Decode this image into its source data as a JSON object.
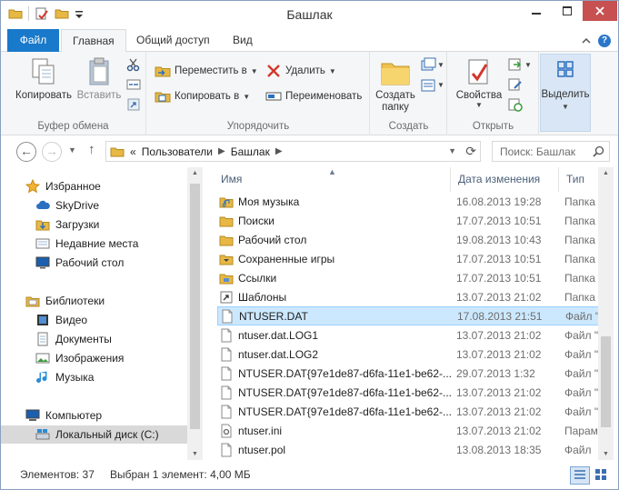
{
  "window": {
    "title": "Башлак",
    "colors": {
      "file_tab": "#1979ca",
      "selection": "#cce8ff",
      "close_button": "#c75050"
    }
  },
  "ribbon_tabs": {
    "file": "Файл",
    "home": "Главная",
    "share": "Общий доступ",
    "view": "Вид"
  },
  "ribbon": {
    "clipboard": {
      "copy": "Копировать",
      "paste": "Вставить",
      "label": "Буфер обмена"
    },
    "organize": {
      "move_to": "Переместить в",
      "copy_to": "Копировать в",
      "delete": "Удалить",
      "rename": "Переименовать",
      "label": "Упорядочить"
    },
    "new": {
      "new_folder_line1": "Создать",
      "new_folder_line2": "папку",
      "label": "Создать"
    },
    "open": {
      "properties": "Свойства",
      "label": "Открыть"
    },
    "select": {
      "select": "Выделить"
    }
  },
  "address": {
    "overflow": "«",
    "crumbs": [
      "Пользователи",
      "Башлак"
    ],
    "search_placeholder": "Поиск: Башлак"
  },
  "nav": {
    "favorites": "Избранное",
    "skydrive": "SkyDrive",
    "downloads": "Загрузки",
    "recent": "Недавние места",
    "desktop": "Рабочий стол",
    "libraries": "Библиотеки",
    "video": "Видео",
    "documents": "Документы",
    "pictures": "Изображения",
    "music": "Музыка",
    "computer": "Компьютер",
    "local_disk": "Локальный диск (C:)"
  },
  "columns": {
    "name": "Имя",
    "date": "Дата изменения",
    "type": "Тип"
  },
  "files": [
    {
      "name": "Моя музыка",
      "date": "16.08.2013 19:28",
      "type": "Папка",
      "icon": "folder-music-icon"
    },
    {
      "name": "Поиски",
      "date": "17.07.2013 10:51",
      "type": "Папка",
      "icon": "folder-icon"
    },
    {
      "name": "Рабочий стол",
      "date": "19.08.2013 10:43",
      "type": "Папка",
      "icon": "folder-icon"
    },
    {
      "name": "Сохраненные игры",
      "date": "17.07.2013 10:51",
      "type": "Папка",
      "icon": "folder-games-icon"
    },
    {
      "name": "Ссылки",
      "date": "17.07.2013 10:51",
      "type": "Папка",
      "icon": "folder-links-icon"
    },
    {
      "name": "Шаблоны",
      "date": "13.07.2013 21:02",
      "type": "Папка",
      "icon": "shortcut-icon"
    },
    {
      "name": "NTUSER.DAT",
      "date": "17.08.2013 21:51",
      "type": "Файл \"",
      "icon": "file-icon"
    },
    {
      "name": "ntuser.dat.LOG1",
      "date": "13.07.2013 21:02",
      "type": "Файл \"",
      "icon": "file-icon"
    },
    {
      "name": "ntuser.dat.LOG2",
      "date": "13.07.2013 21:02",
      "type": "Файл \"",
      "icon": "file-icon"
    },
    {
      "name": "NTUSER.DAT{97e1de87-d6fa-11e1-be62-...",
      "date": "29.07.2013 1:32",
      "type": "Файл \"",
      "icon": "file-icon"
    },
    {
      "name": "NTUSER.DAT{97e1de87-d6fa-11e1-be62-...",
      "date": "13.07.2013 21:02",
      "type": "Файл \"",
      "icon": "file-icon"
    },
    {
      "name": "NTUSER.DAT{97e1de87-d6fa-11e1-be62-...",
      "date": "13.07.2013 21:02",
      "type": "Файл \"",
      "icon": "file-icon"
    },
    {
      "name": "ntuser.ini",
      "date": "13.07.2013 21:02",
      "type": "Парам",
      "icon": "settings-file-icon"
    },
    {
      "name": "ntuser.pol",
      "date": "13.08.2013 18:35",
      "type": "Файл",
      "icon": "file-icon"
    }
  ],
  "selected_index": 6,
  "status": {
    "count": "Элементов: 37",
    "selection": "Выбран 1 элемент: 4,00 МБ"
  }
}
